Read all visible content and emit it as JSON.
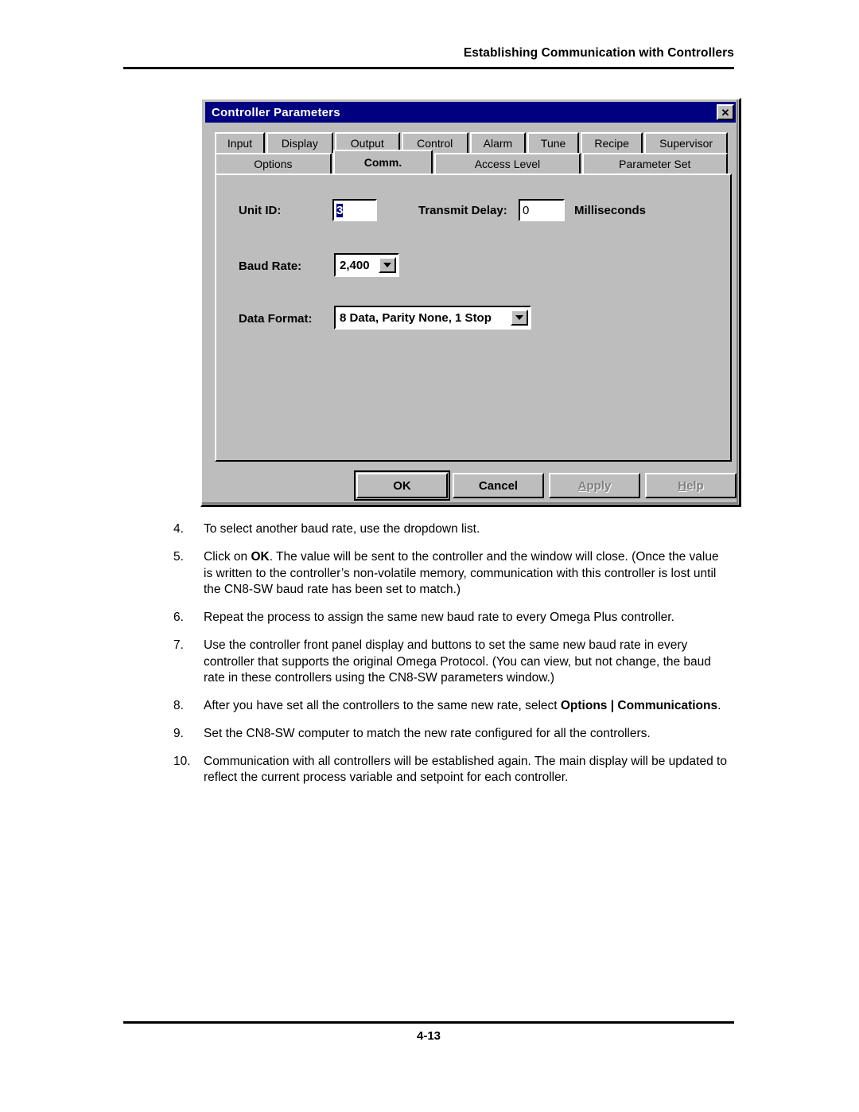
{
  "page": {
    "header_title": "Establishing Communication with Controllers",
    "footer_page": "4-13"
  },
  "dialog": {
    "title": "Controller Parameters",
    "close_label": "✕",
    "tabs_row1": [
      {
        "label": "Input",
        "class": "t-input",
        "active": false
      },
      {
        "label": "Display",
        "class": "t-display",
        "active": false
      },
      {
        "label": "Output",
        "class": "t-output",
        "active": false
      },
      {
        "label": "Control",
        "class": "t-control",
        "active": false
      },
      {
        "label": "Alarm",
        "class": "t-alarm",
        "active": false
      },
      {
        "label": "Tune",
        "class": "t-tune",
        "active": false
      },
      {
        "label": "Recipe",
        "class": "t-recipe",
        "active": false
      },
      {
        "label": "Supervisor",
        "class": "t-supervisor",
        "active": false
      }
    ],
    "tabs_row2": [
      {
        "label": "Options",
        "class": "t-options",
        "active": false
      },
      {
        "label": "Comm.",
        "class": "t-comm",
        "active": true
      },
      {
        "label": "Access Level",
        "class": "t-access",
        "active": false
      },
      {
        "label": "Parameter Set",
        "class": "t-paramset",
        "active": false
      }
    ],
    "fields": {
      "unit_id_label": "Unit ID:",
      "unit_id_value": "3",
      "transmit_delay_label": "Transmit Delay:",
      "transmit_delay_value": "0",
      "transmit_delay_units": "Milliseconds",
      "baud_rate_label": "Baud Rate:",
      "baud_rate_value": "2,400",
      "data_format_label": "Data Format:",
      "data_format_value": "8 Data, Parity None, 1 Stop"
    },
    "buttons": {
      "ok": "OK",
      "cancel": "Cancel",
      "apply": "Apply",
      "apply_prefix": "A",
      "apply_rest": "pply",
      "help": "Help",
      "help_prefix": "H",
      "help_rest": "elp"
    },
    "colors": {
      "titlebar": "#000080",
      "face": "#bdbdbd",
      "selection": "#000080"
    }
  },
  "steps": [
    {
      "num": "4.",
      "parts": [
        {
          "t": "To select another baud rate, use the dropdown list.",
          "b": false
        }
      ]
    },
    {
      "num": "5.",
      "parts": [
        {
          "t": "Click on ",
          "b": false
        },
        {
          "t": "OK",
          "b": true
        },
        {
          "t": ".  The value will be sent to the controller and the window will close. (Once the value is written to the controller’s non-volatile memory, communication with this controller is lost until the CN8-SW baud rate has been set to match.)",
          "b": false
        }
      ]
    },
    {
      "num": "6.",
      "parts": [
        {
          "t": "Repeat the process to assign the same new baud rate to every Omega Plus controller.",
          "b": false
        }
      ]
    },
    {
      "num": "7.",
      "parts": [
        {
          "t": "Use the controller front panel display and buttons to set the same new baud rate in every controller that supports the original Omega Protocol.  (You can view, but not change, the baud rate in these controllers using the CN8-SW parameters window.)",
          "b": false
        }
      ]
    },
    {
      "num": "8.",
      "parts": [
        {
          "t": "After you have set all the controllers to the same new rate, select ",
          "b": false
        },
        {
          "t": "Options | Communications",
          "b": true
        },
        {
          "t": ".",
          "b": false
        }
      ]
    },
    {
      "num": "9.",
      "parts": [
        {
          "t": "Set the CN8-SW computer to match the new rate configured for all the controllers.",
          "b": false
        }
      ]
    },
    {
      "num": "10.",
      "parts": [
        {
          "t": "Communication with all controllers will be established again.  The main display will be updated to reflect the current process variable and setpoint for each controller.",
          "b": false
        }
      ]
    }
  ]
}
